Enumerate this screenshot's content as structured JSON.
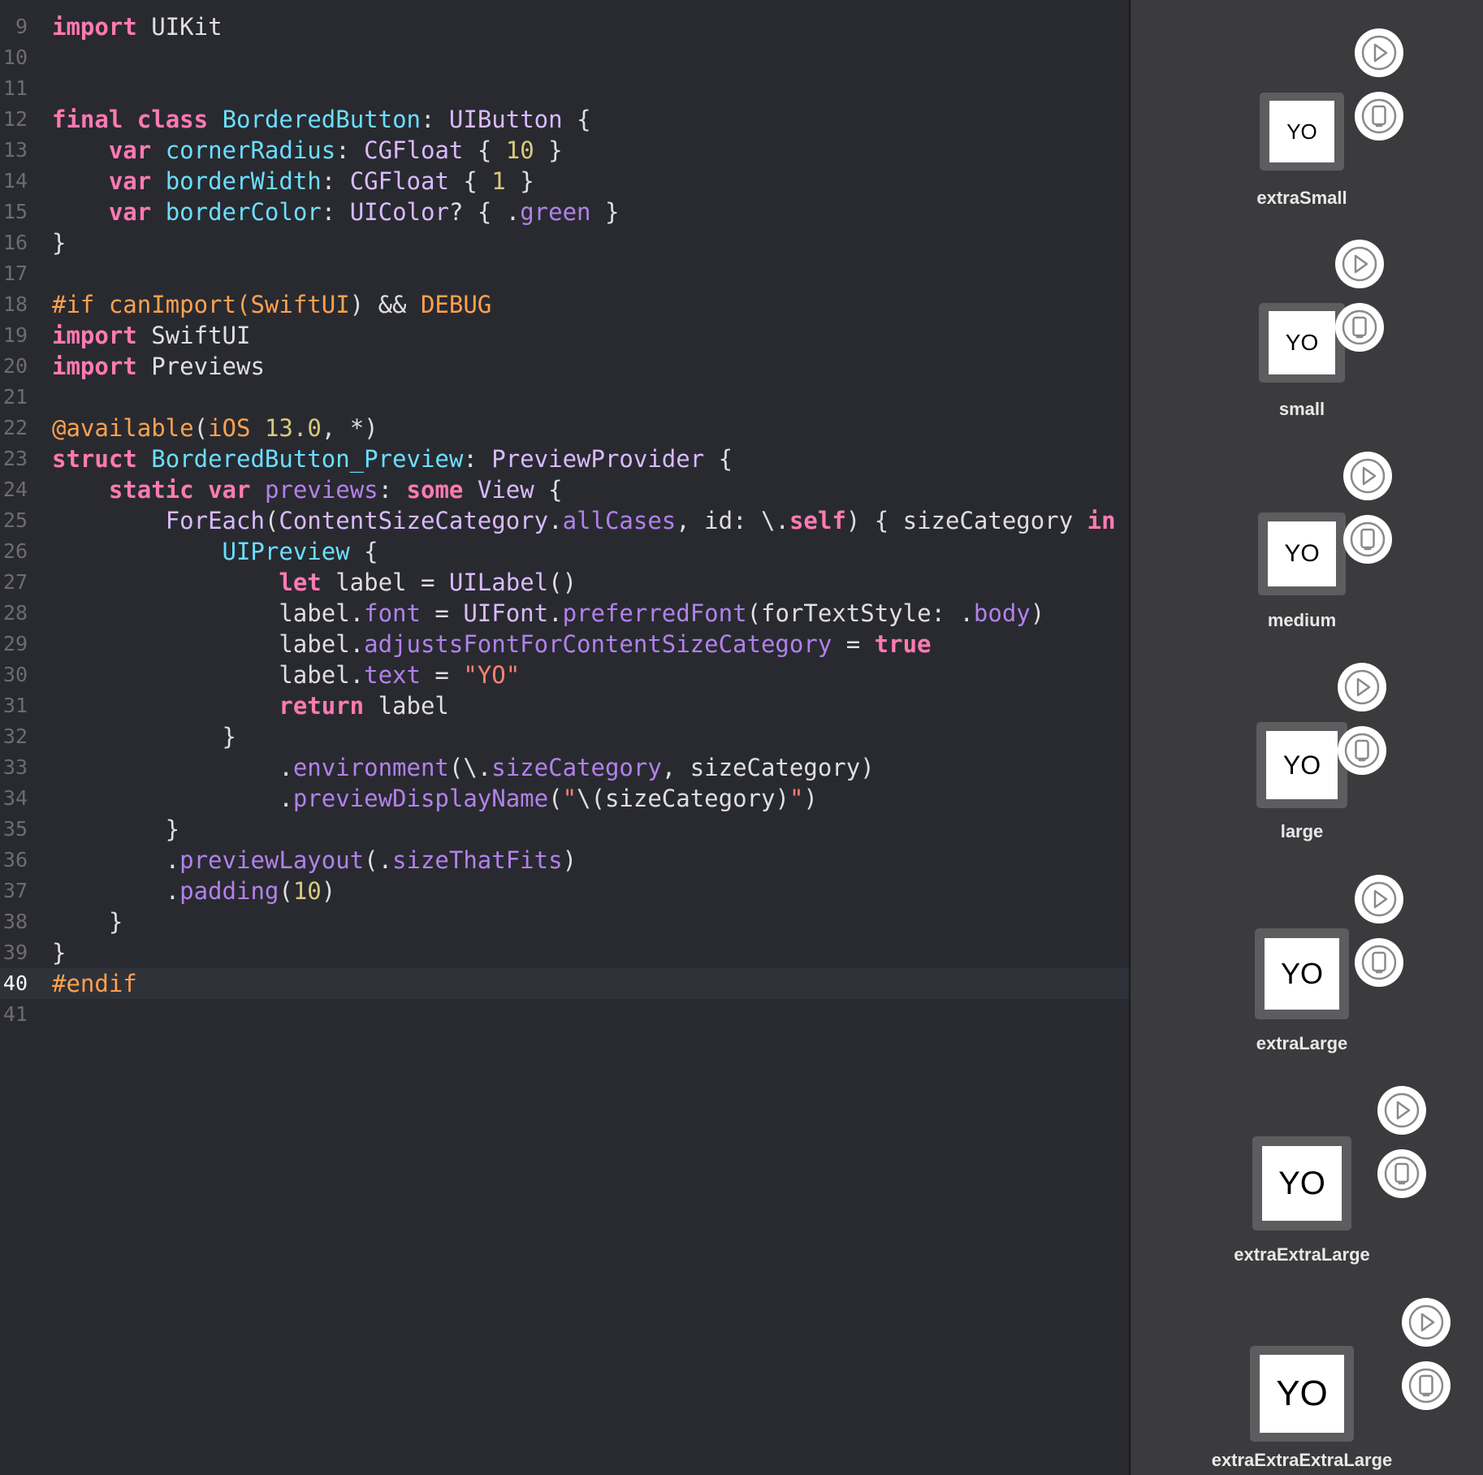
{
  "editor": {
    "current_line": 40,
    "lines": [
      {
        "n": 9,
        "tokens": [
          [
            "import",
            "keyword"
          ],
          [
            " UIKit",
            "plain"
          ]
        ]
      },
      {
        "n": 10,
        "tokens": []
      },
      {
        "n": 11,
        "tokens": []
      },
      {
        "n": 12,
        "tokens": [
          [
            "final",
            "keyword"
          ],
          [
            " ",
            "plain"
          ],
          [
            "class",
            "keyword"
          ],
          [
            " ",
            "plain"
          ],
          [
            "BorderedButton",
            "decl"
          ],
          [
            ": ",
            "plain"
          ],
          [
            "UIButton",
            "type"
          ],
          [
            " {",
            "plain"
          ]
        ]
      },
      {
        "n": 13,
        "tokens": [
          [
            "    ",
            "plain"
          ],
          [
            "var",
            "keyword"
          ],
          [
            " ",
            "plain"
          ],
          [
            "cornerRadius",
            "decl"
          ],
          [
            ": ",
            "plain"
          ],
          [
            "CGFloat",
            "type"
          ],
          [
            " { ",
            "plain"
          ],
          [
            "10",
            "number"
          ],
          [
            " }",
            "plain"
          ]
        ]
      },
      {
        "n": 14,
        "tokens": [
          [
            "    ",
            "plain"
          ],
          [
            "var",
            "keyword"
          ],
          [
            " ",
            "plain"
          ],
          [
            "borderWidth",
            "decl"
          ],
          [
            ": ",
            "plain"
          ],
          [
            "CGFloat",
            "type"
          ],
          [
            " { ",
            "plain"
          ],
          [
            "1",
            "number"
          ],
          [
            " }",
            "plain"
          ]
        ]
      },
      {
        "n": 15,
        "tokens": [
          [
            "    ",
            "plain"
          ],
          [
            "var",
            "keyword"
          ],
          [
            " ",
            "plain"
          ],
          [
            "borderColor",
            "decl"
          ],
          [
            ": ",
            "plain"
          ],
          [
            "UIColor",
            "type"
          ],
          [
            "? { .",
            "plain"
          ],
          [
            "green",
            "member"
          ],
          [
            " }",
            "plain"
          ]
        ]
      },
      {
        "n": 16,
        "tokens": [
          [
            "}",
            "plain"
          ]
        ]
      },
      {
        "n": 17,
        "tokens": []
      },
      {
        "n": 18,
        "tokens": [
          [
            "#if canImport(",
            "preproc"
          ],
          [
            "SwiftUI",
            "preproc"
          ],
          [
            ") && ",
            "plain"
          ],
          [
            "DEBUG",
            "preproc"
          ]
        ]
      },
      {
        "n": 19,
        "tokens": [
          [
            "import",
            "keyword"
          ],
          [
            " SwiftUI",
            "plain"
          ]
        ]
      },
      {
        "n": 20,
        "tokens": [
          [
            "import",
            "keyword"
          ],
          [
            " Previews",
            "plain"
          ]
        ]
      },
      {
        "n": 21,
        "tokens": []
      },
      {
        "n": 22,
        "tokens": [
          [
            "@available",
            "attr"
          ],
          [
            "(",
            "plain"
          ],
          [
            "iOS",
            "attr"
          ],
          [
            " ",
            "plain"
          ],
          [
            "13.0",
            "number"
          ],
          [
            ", *)",
            "plain"
          ]
        ]
      },
      {
        "n": 23,
        "tokens": [
          [
            "struct",
            "keyword"
          ],
          [
            " ",
            "plain"
          ],
          [
            "BorderedButton_Preview",
            "decl"
          ],
          [
            ": ",
            "plain"
          ],
          [
            "PreviewProvider",
            "type"
          ],
          [
            " {",
            "plain"
          ]
        ]
      },
      {
        "n": 24,
        "tokens": [
          [
            "    ",
            "plain"
          ],
          [
            "static",
            "keyword"
          ],
          [
            " ",
            "plain"
          ],
          [
            "var",
            "keyword"
          ],
          [
            " ",
            "plain"
          ],
          [
            "previews",
            "member"
          ],
          [
            ": ",
            "plain"
          ],
          [
            "some",
            "keyword"
          ],
          [
            " ",
            "plain"
          ],
          [
            "View",
            "type"
          ],
          [
            " {",
            "plain"
          ]
        ]
      },
      {
        "n": 25,
        "tokens": [
          [
            "        ",
            "plain"
          ],
          [
            "ForEach",
            "type"
          ],
          [
            "(",
            "plain"
          ],
          [
            "ContentSizeCategory",
            "type"
          ],
          [
            ".",
            "plain"
          ],
          [
            "allCases",
            "member"
          ],
          [
            ", id: \\.",
            "plain"
          ],
          [
            "self",
            "keyword"
          ],
          [
            ") { sizeCategory ",
            "plain"
          ],
          [
            "in",
            "keyword"
          ]
        ]
      },
      {
        "n": 26,
        "tokens": [
          [
            "            ",
            "plain"
          ],
          [
            "UIPreview",
            "decl"
          ],
          [
            " {",
            "plain"
          ]
        ]
      },
      {
        "n": 27,
        "tokens": [
          [
            "                ",
            "plain"
          ],
          [
            "let",
            "keyword"
          ],
          [
            " label = ",
            "plain"
          ],
          [
            "UILabel",
            "type"
          ],
          [
            "()",
            "plain"
          ]
        ]
      },
      {
        "n": 28,
        "tokens": [
          [
            "                label.",
            "plain"
          ],
          [
            "font",
            "member"
          ],
          [
            " = ",
            "plain"
          ],
          [
            "UIFont",
            "type"
          ],
          [
            ".",
            "plain"
          ],
          [
            "preferredFont",
            "member"
          ],
          [
            "(forTextStyle: .",
            "plain"
          ],
          [
            "body",
            "member"
          ],
          [
            ")",
            "plain"
          ]
        ]
      },
      {
        "n": 29,
        "tokens": [
          [
            "                label.",
            "plain"
          ],
          [
            "adjustsFontForContentSizeCategory",
            "member"
          ],
          [
            " = ",
            "plain"
          ],
          [
            "true",
            "keyword"
          ]
        ]
      },
      {
        "n": 30,
        "tokens": [
          [
            "                label.",
            "plain"
          ],
          [
            "text",
            "member"
          ],
          [
            " = ",
            "plain"
          ],
          [
            "\"YO\"",
            "string"
          ]
        ]
      },
      {
        "n": 31,
        "tokens": [
          [
            "                ",
            "plain"
          ],
          [
            "return",
            "keyword"
          ],
          [
            " label",
            "plain"
          ]
        ]
      },
      {
        "n": 32,
        "tokens": [
          [
            "            }",
            "plain"
          ]
        ]
      },
      {
        "n": 33,
        "tokens": [
          [
            "                .",
            "plain"
          ],
          [
            "environment",
            "member"
          ],
          [
            "(\\.",
            "plain"
          ],
          [
            "sizeCategory",
            "member"
          ],
          [
            ", sizeCategory)",
            "plain"
          ]
        ]
      },
      {
        "n": 34,
        "tokens": [
          [
            "                .",
            "plain"
          ],
          [
            "previewDisplayName",
            "member"
          ],
          [
            "(",
            "plain"
          ],
          [
            "\"",
            "string"
          ],
          [
            "\\(sizeCategory)",
            "plain"
          ],
          [
            "\"",
            "string"
          ],
          [
            ")",
            "plain"
          ]
        ]
      },
      {
        "n": 35,
        "tokens": [
          [
            "        }",
            "plain"
          ]
        ]
      },
      {
        "n": 36,
        "tokens": [
          [
            "        .",
            "plain"
          ],
          [
            "previewLayout",
            "member"
          ],
          [
            "(.",
            "plain"
          ],
          [
            "sizeThatFits",
            "member"
          ],
          [
            ")",
            "plain"
          ]
        ]
      },
      {
        "n": 37,
        "tokens": [
          [
            "        .",
            "plain"
          ],
          [
            "padding",
            "member"
          ],
          [
            "(",
            "plain"
          ],
          [
            "10",
            "number"
          ],
          [
            ")",
            "plain"
          ]
        ]
      },
      {
        "n": 38,
        "tokens": [
          [
            "    }",
            "plain"
          ]
        ]
      },
      {
        "n": 39,
        "tokens": [
          [
            "}",
            "plain"
          ]
        ]
      },
      {
        "n": 40,
        "tokens": [
          [
            "#endif",
            "preproc"
          ]
        ]
      },
      {
        "n": 41,
        "tokens": []
      }
    ]
  },
  "previews": [
    {
      "label": "YO",
      "name": "extraSmall"
    },
    {
      "label": "YO",
      "name": "small"
    },
    {
      "label": "YO",
      "name": "medium"
    },
    {
      "label": "YO",
      "name": "large"
    },
    {
      "label": "YO",
      "name": "extraLarge"
    },
    {
      "label": "YO",
      "name": "extraExtraLarge"
    },
    {
      "label": "YO",
      "name": "extraExtraExtraLarge"
    }
  ],
  "icons": {
    "live_preview": "play-circle-icon",
    "preview_on_device": "device-circle-icon"
  },
  "colors": {
    "editor_background": "#292a30",
    "preview_background": "#3b3b3e",
    "keyword": "#ff7ab2",
    "declaration": "#6bdfff",
    "type": "#dabaff",
    "member": "#b281eb",
    "number": "#d9c97c",
    "string": "#ff8170",
    "preprocessor": "#ffa14f"
  }
}
